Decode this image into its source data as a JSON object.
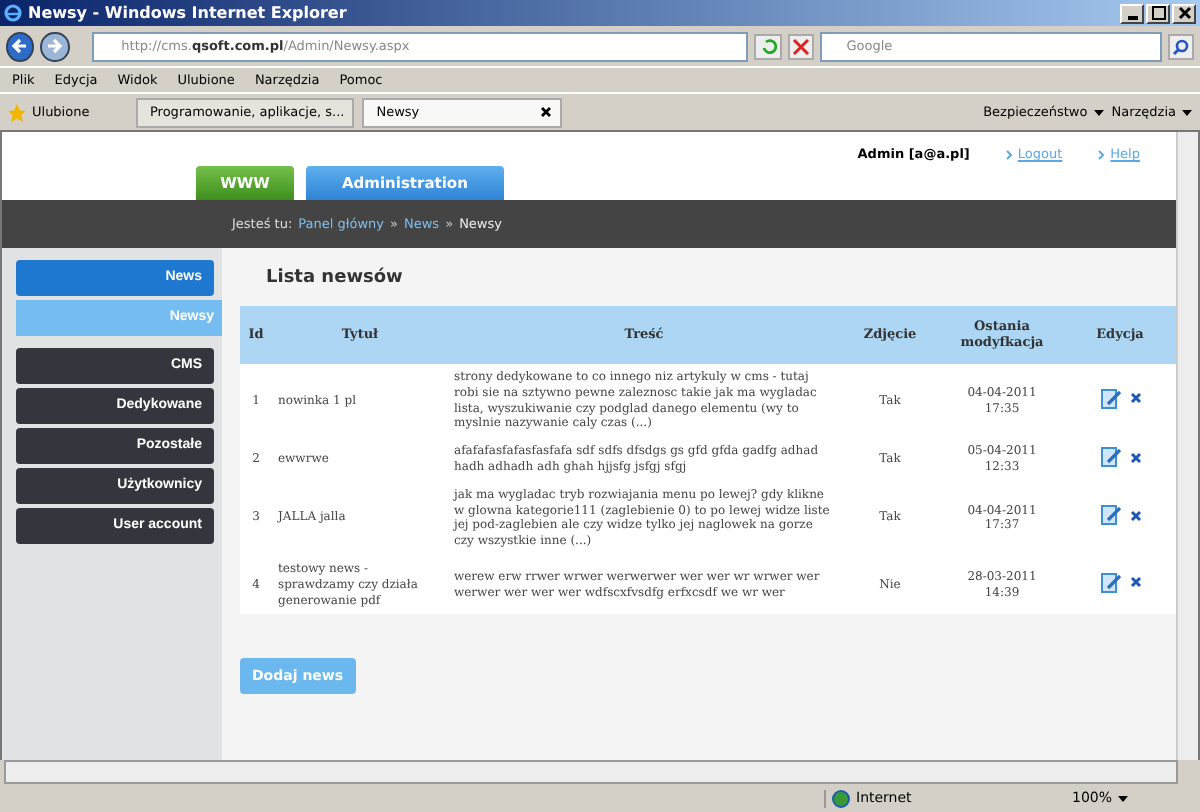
{
  "window": {
    "title": "Newsy - Windows Internet Explorer"
  },
  "address_bar": {
    "url_prefix": "http://cms.",
    "url_domain": "qsoft.com.pl",
    "url_path": "/Admin/Newsy.aspx",
    "search_placeholder": "Google"
  },
  "menu_bar": [
    "Plik",
    "Edycja",
    "Widok",
    "Ulubione",
    "Narzędzia",
    "Pomoc"
  ],
  "favorites_bar": {
    "favorites": "Ulubione",
    "tabs": [
      {
        "label": "Programowanie, aplikacje, s...",
        "selected": false
      },
      {
        "label": "Newsy",
        "selected": true
      }
    ],
    "tools": [
      "Bezpieczeństwo",
      "Narzędzia"
    ]
  },
  "page": {
    "user": "Admin [a@a.pl]",
    "links": [
      "Logout",
      "Help"
    ],
    "top_tabs": [
      {
        "label": "WWW",
        "selected": false
      },
      {
        "label": "Administration",
        "selected": true
      }
    ],
    "breadcrumb": {
      "prefix": "Jesteś tu:",
      "separator": "»",
      "items": [
        {
          "label": "Panel główny",
          "current": false
        },
        {
          "label": "News",
          "current": false
        },
        {
          "label": "Newsy",
          "current": true
        }
      ]
    },
    "sidebar": [
      {
        "label": "News",
        "kind": "section"
      },
      {
        "label": "Newsy",
        "kind": "sub"
      },
      {
        "label": "CMS",
        "kind": "item"
      },
      {
        "label": "Dedykowane",
        "kind": "item"
      },
      {
        "label": "Pozostałe",
        "kind": "item"
      },
      {
        "label": "Użytkownicy",
        "kind": "item"
      },
      {
        "label": "User account",
        "kind": "item"
      }
    ],
    "heading": "Lista newsów",
    "table": {
      "columns": [
        "Id",
        "Tytuł",
        "Treść",
        "Zdjęcie",
        "Ostania modyfkacja",
        "Edycja"
      ],
      "rows": [
        {
          "id": "1",
          "title": "nowinka 1 pl",
          "content": "strony dedykowane to co innego niz artykuly w cms - tutaj robi sie na sztywno pewne zaleznosc takie jak ma wygladac lista, wyszukiwanie czy podglad danego elementu (wy to myslnie nazywanie caly czas (...)",
          "photo": "Tak",
          "date": "04-04-2011",
          "time": "17:35"
        },
        {
          "id": "2",
          "title": "ewwrwe",
          "content": "afafafasfafasfasfafa sdf sdfs dfsdgs gs gfd gfda gadfg adhad hadh adhadh adh ghah hjjsfg jsfgj sfgj",
          "photo": "Tak",
          "date": "05-04-2011",
          "time": "12:33"
        },
        {
          "id": "3",
          "title": "JALLA jalla",
          "content": "jak ma wygladac tryb rozwiajania menu po lewej? gdy klikne w glowna kategorie111 (zaglebienie 0) to po lewej widze liste jej pod-zaglebien ale czy widze tylko jej naglowek na gorze czy wszystkie inne (...)",
          "photo": "Tak",
          "date": "04-04-2011",
          "time": "17:37"
        },
        {
          "id": "4",
          "title": "testowy news - sprawdzamy czy działa generowanie pdf",
          "content": "werew erw rrwer wrwer werwerwer wer wer wr wrwer wer werwer wer wer wer wdfscxfvsdfg erfxcsdf we wr wer",
          "photo": "Nie",
          "date": "28-03-2011",
          "time": "14:39"
        }
      ]
    },
    "add_button": "Dodaj news"
  },
  "status_bar": {
    "zone": "Internet",
    "zoom": "100%"
  }
}
